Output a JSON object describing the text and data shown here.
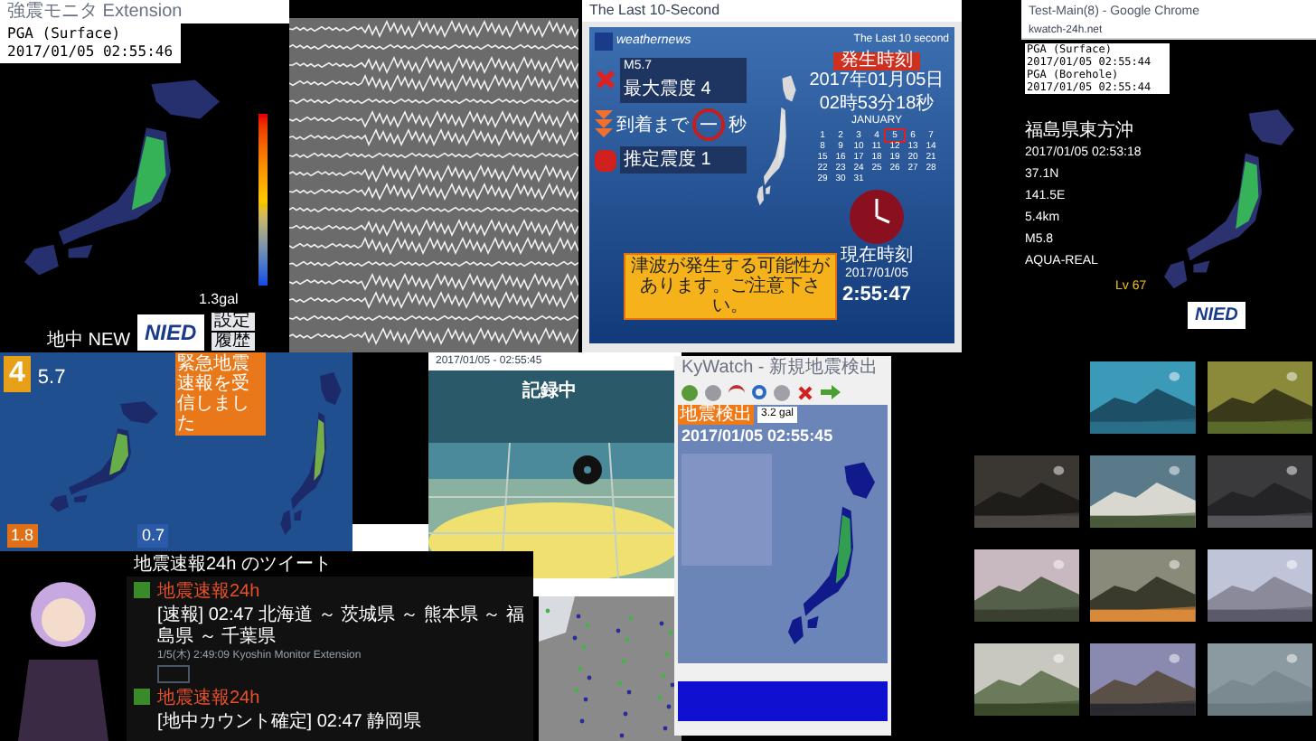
{
  "kmoni": {
    "title": "強震モニタ Extension",
    "pga_label": "PGA (Surface)",
    "time": "2017/01/05 02:55:46",
    "peak": "1.3gal",
    "logo": "NIED",
    "buttons": [
      "設定",
      "履歴"
    ],
    "footer": "地中 NEW"
  },
  "last10": {
    "title": "The Last 10-Second",
    "brand": "weathernews",
    "subtitle": "The Last 10 second",
    "magnitude": "M5.7",
    "max_label": "最大震度 4",
    "arrival_label": "到着まで",
    "countdown": "—",
    "seconds_unit": "秒",
    "estimate_label": "推定震度 1",
    "origin_label": "発生時刻",
    "origin_date": "2017年01月05日",
    "origin_time": "02時53分18秒",
    "month": "JANUARY",
    "calendar": [
      {
        "day": "1",
        "selected": false
      },
      {
        "day": "2",
        "selected": false
      },
      {
        "day": "3",
        "selected": false
      },
      {
        "day": "4",
        "selected": false
      },
      {
        "day": "5",
        "selected": true
      },
      {
        "day": "6",
        "selected": false
      },
      {
        "day": "7",
        "selected": false
      },
      {
        "day": "8",
        "selected": false
      },
      {
        "day": "9",
        "selected": false
      },
      {
        "day": "10",
        "selected": false
      },
      {
        "day": "11",
        "selected": false
      },
      {
        "day": "12",
        "selected": false
      },
      {
        "day": "13",
        "selected": false
      },
      {
        "day": "14",
        "selected": false
      },
      {
        "day": "15",
        "selected": false
      },
      {
        "day": "16",
        "selected": false
      },
      {
        "day": "17",
        "selected": false
      },
      {
        "day": "18",
        "selected": false
      },
      {
        "day": "19",
        "selected": false
      },
      {
        "day": "20",
        "selected": false
      },
      {
        "day": "21",
        "selected": false
      },
      {
        "day": "22",
        "selected": false
      },
      {
        "day": "23",
        "selected": false
      },
      {
        "day": "24",
        "selected": false
      },
      {
        "day": "25",
        "selected": false
      },
      {
        "day": "26",
        "selected": false
      },
      {
        "day": "27",
        "selected": false
      },
      {
        "day": "28",
        "selected": false
      },
      {
        "day": "29",
        "selected": false
      },
      {
        "day": "30",
        "selected": false
      },
      {
        "day": "31",
        "selected": false
      }
    ],
    "clock_label": "現在時刻",
    "now_date": "2017/01/05",
    "now_time": "2:55:47",
    "tsunami": "津波が発生する可能性があります。ご注意下さい。"
  },
  "chrome": {
    "title": "Test-Main(8) - Google Chrome",
    "url": "kwatch-24h.net",
    "pga_lines": [
      "PGA (Surface)",
      "2017/01/05 02:55:44",
      "PGA (Borehole)",
      "2017/01/05 02:55:44"
    ],
    "info": [
      "福島県東方沖",
      "2017/01/05 02:53:18",
      "37.1N",
      "141.5E",
      "5.4km",
      "M5.8",
      "AQUA-REAL"
    ],
    "level": "Lv 67",
    "logo": "NIED"
  },
  "region_panel": {
    "intensity": "4",
    "magnitude": "5.7",
    "left_value": "1.8",
    "right_value": "0.7"
  },
  "alert_panel": {
    "message": "緊急地震速報を受信しました"
  },
  "camera": {
    "time": "2017/01/05 - 02:55:45",
    "status": "記録中"
  },
  "tweets": {
    "header": "地震速報24h のツイート",
    "items": [
      {
        "user": "地震速報24h",
        "text": "[速報] 02:47 北海道 ～ 茨城県 ～ 熊本県 ～ 福島県 ～ 千葉県",
        "meta": "1/5(木) 2:49:09 Kyoshin Monitor Extension"
      },
      {
        "user": "地震速報24h",
        "text": "[地中カウント確定] 02:47 静岡県"
      }
    ]
  },
  "kywatch": {
    "title": "KyWatch - 新規地震検出",
    "tag": "地震検出",
    "threshold": "3.2 gal",
    "time": "2017/01/05 02:55:45"
  }
}
